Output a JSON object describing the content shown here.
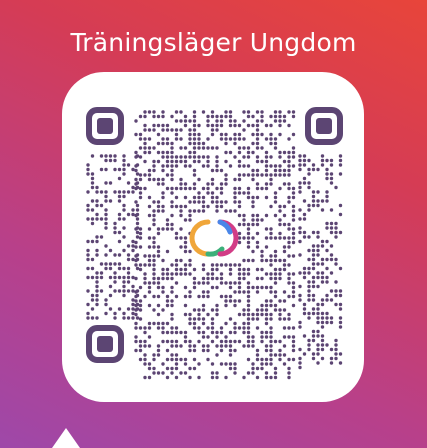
{
  "card": {
    "title": "Träningsläger Ungdom"
  },
  "qr": {
    "module_color": "#5c4573",
    "logo_colors": [
      "#f0a63a",
      "#d23c86",
      "#4a86e8",
      "#3cb07a"
    ]
  },
  "icons": [
    "qr-code-icon",
    "share-pointer-icon"
  ]
}
